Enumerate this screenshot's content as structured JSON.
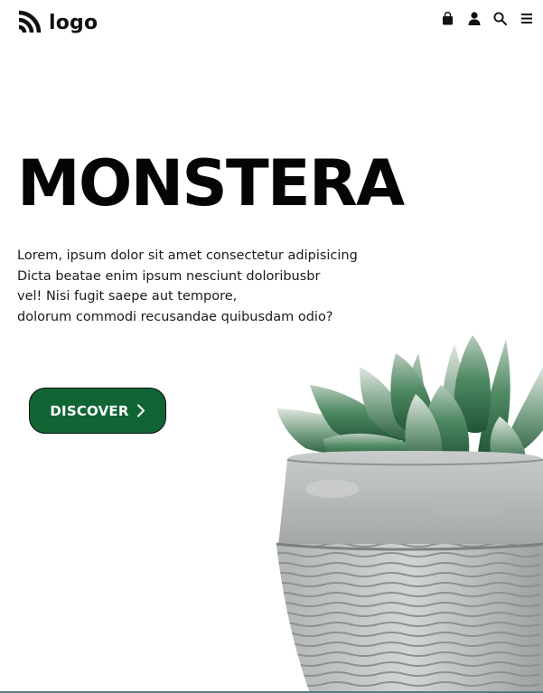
{
  "header": {
    "logo_text": "logo",
    "logo_icon": "rss-icon",
    "nav_icons": [
      "shopping-bag-icon",
      "user-icon",
      "search-icon",
      "menu-icon"
    ]
  },
  "hero": {
    "title": "MONSTERA",
    "description_lines": [
      "Lorem, ipsum dolor sit amet consectetur adipisicing",
      "Dicta beatae enim ipsum nesciunt doloribusbr",
      "vel! Nisi fugit saepe aut tempore,",
      "dolorum commodi recusandae quibusdam odio?"
    ],
    "cta_label": "DISCOVER",
    "cta_icon": "chevron-right-icon"
  },
  "colors": {
    "cta_background": "#116535",
    "text": "#050505",
    "background": "#ffffff"
  }
}
